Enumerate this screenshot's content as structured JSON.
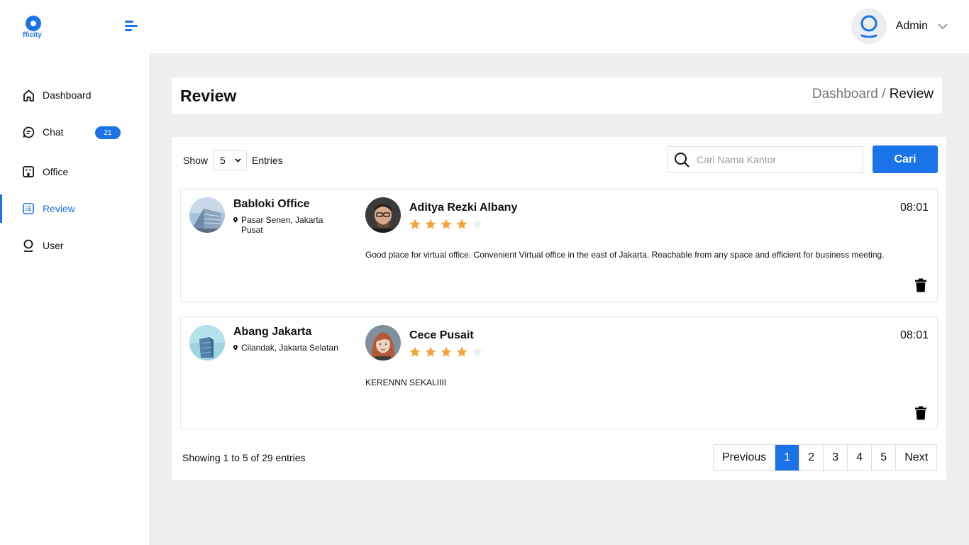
{
  "brand": {
    "logo_text": "fficity",
    "accent": "#1a73e8"
  },
  "header": {
    "user_name": "Admin"
  },
  "sidebar": {
    "items": [
      {
        "label": "Dashboard",
        "icon": "home-icon"
      },
      {
        "label": "Chat",
        "icon": "chat-icon",
        "badge": "21"
      },
      {
        "label": "Office",
        "icon": "office-icon"
      },
      {
        "label": "Review",
        "icon": "review-icon",
        "active": true
      },
      {
        "label": "User",
        "icon": "user-icon"
      }
    ]
  },
  "page": {
    "title": "Review",
    "breadcrumb": {
      "parent": "Dashboard",
      "separator": "/",
      "current": "Review"
    }
  },
  "controls": {
    "show_label": "Show",
    "entries_value": "5",
    "entries_label": "Entries",
    "search_placeholder": "Cari Nama Kantor",
    "search_value": "",
    "search_button": "Cari"
  },
  "reviews": [
    {
      "office_name": "Babloki Office",
      "office_location": "Pasar Senen, Jakarta Pusat",
      "reviewer": "Aditya Rezki Albany",
      "rating": 4,
      "max_rating": 5,
      "time": "08:01",
      "text": "Good place for virtual office. Convenient Virtual office in the east of Jakarta. Reachable from any space and efficient for business meeting."
    },
    {
      "office_name": "Abang Jakarta",
      "office_location": "Cilandak, Jakarta Selatan",
      "reviewer": "Cece Pusait",
      "rating": 4,
      "max_rating": 5,
      "time": "08:01",
      "text": "KERENNN SEKALIIII"
    }
  ],
  "footer": {
    "showing_text": "Showing 1 to 5 of 29 entries",
    "pagination": {
      "previous": "Previous",
      "pages": [
        "1",
        "2",
        "3",
        "4",
        "5"
      ],
      "current": "1",
      "next": "Next"
    }
  }
}
